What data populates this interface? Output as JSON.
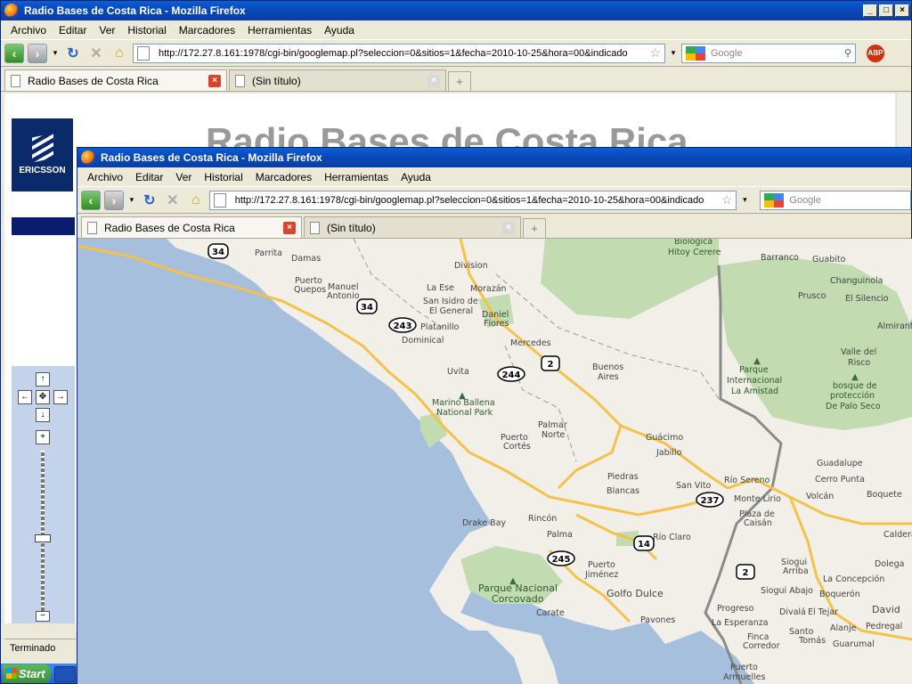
{
  "browser": {
    "window_title": "Radio Bases de Costa Rica - Mozilla Firefox",
    "menu": [
      "Archivo",
      "Editar",
      "Ver",
      "Historial",
      "Marcadores",
      "Herramientas",
      "Ayuda"
    ],
    "url": "http://172.27.8.161:1978/cgi-bin/googlemap.pl?seleccion=0&sitios=1&fecha=2010-10-25&hora=00&indicado",
    "search_placeholder": "Google",
    "tabs": [
      {
        "label": "Radio Bases de Costa Rica",
        "active": true
      },
      {
        "label": "(Sin título)",
        "active": false
      }
    ],
    "status": "Terminado"
  },
  "page": {
    "title": "Radio Bases de Costa Rica",
    "logo_text": "ERICSSON"
  },
  "taskbar": {
    "start_label": "Start"
  },
  "map": {
    "places": [
      "Parrita",
      "Damas",
      "Division",
      "Biologica",
      "Hitoy Cerere",
      "Barranco",
      "Guabito",
      "Changuinola",
      "El Silencio",
      "Almirante",
      "Prusco",
      "Puerto",
      "Quepos",
      "Manuel",
      "Antonio",
      "La Ese",
      "Morazán",
      "San Isidro de",
      "El General",
      "Daniel",
      "Flores",
      "Platanillo",
      "Dominical",
      "Mercedes",
      "Uvita",
      "Buenos",
      "Aires",
      "Marino Ballena",
      "National Park",
      "Palmar",
      "Norte",
      "Puerto",
      "Cortés",
      "Guácimo",
      "Jabillo",
      "Parque",
      "Internacional",
      "La Amistad",
      "bosque de",
      "protección",
      "De Palo Seco",
      "Valle del",
      "Risco",
      "Guadalupe",
      "Río Sereno",
      "Cerro Punta",
      "Volcán",
      "Boquete",
      "Monte Lirio",
      "Plaza de",
      "Caisán",
      "San Vito",
      "Piedras",
      "Blancas",
      "Drake Bay",
      "Rincón",
      "Palma",
      "Río Claro",
      "Caldera",
      "Puerto",
      "Jiménez",
      "Golfo Dulce",
      "Parque Nacional",
      "Corcovado",
      "Carate",
      "Pavones",
      "Siogui",
      "Arriba",
      "Dolega",
      "La Concepción",
      "Siogui Abajo",
      "Boquerón",
      "Progreso",
      "Divalá",
      "El Tejar",
      "David",
      "La Esperanza",
      "Santo",
      "Tomás",
      "Alanje",
      "Pedregal",
      "Finca",
      "Corredor",
      "Guarumal",
      "Puerto",
      "Armuelles"
    ],
    "route_shields": [
      "34",
      "34",
      "243",
      "2",
      "244",
      "237",
      "14",
      "245",
      "2"
    ]
  },
  "colors": {
    "water": "#a5bfdd",
    "land": "#f2efe9",
    "park": "#c2dbb0",
    "roads": "#f5c14a",
    "title_bar": "#0a5fd8"
  }
}
